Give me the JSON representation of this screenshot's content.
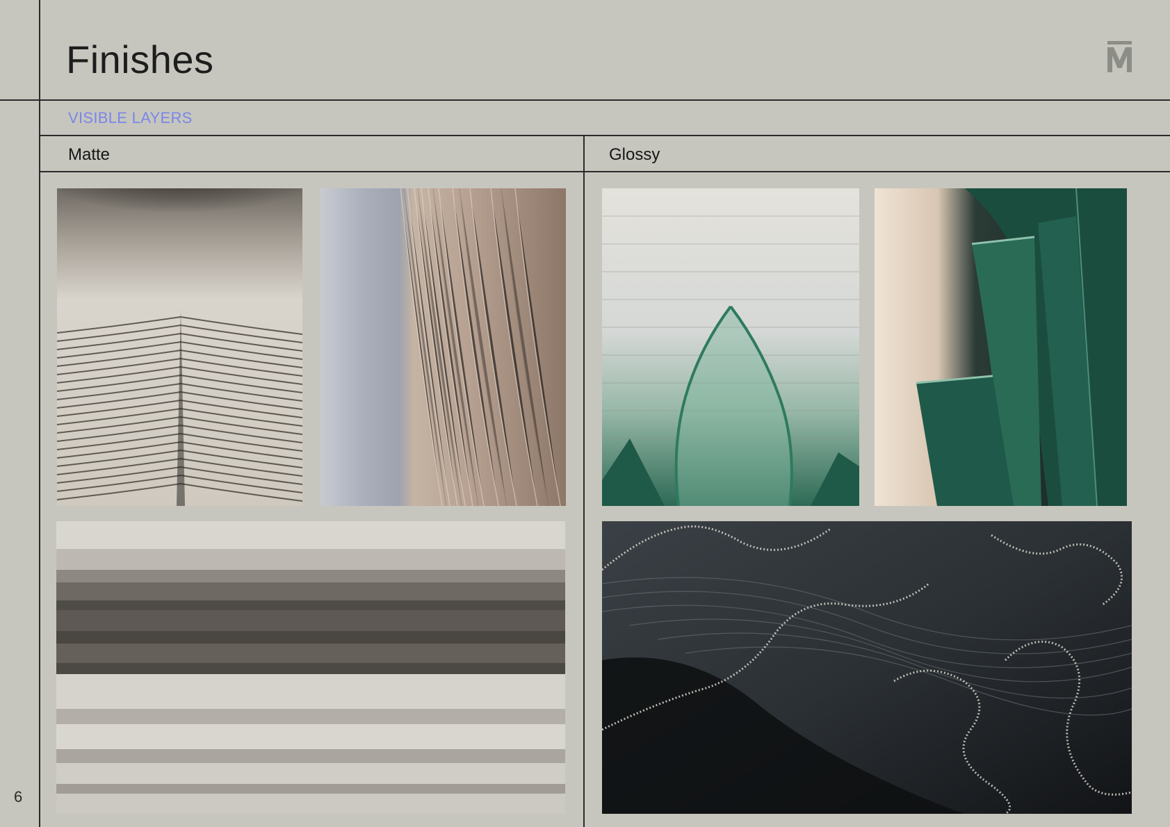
{
  "page": {
    "title": "Finishes",
    "section_label": "VISIBLE LAYERS",
    "page_number": "6"
  },
  "logo": {
    "icon": "m-monogram-logo"
  },
  "columns": [
    {
      "label": "Matte"
    },
    {
      "label": "Glossy"
    }
  ],
  "photos": [
    {
      "subject": "matte-beige-layered-vessel-closeup",
      "colors": [
        "#d8d3cc",
        "#8a8378"
      ]
    },
    {
      "subject": "matte-beige-textured-wall-closeup",
      "colors": [
        "#b8a393",
        "#aab0bd"
      ]
    },
    {
      "subject": "glossy-translucent-green-vessel",
      "colors": [
        "#d9dbd8",
        "#1f6e55"
      ]
    },
    {
      "subject": "glossy-dark-green-fins",
      "colors": [
        "#1f5a48",
        "#e8dccd"
      ]
    },
    {
      "subject": "matte-grey-layered-texture-wide",
      "colors": [
        "#d2cfca",
        "#4e4a46"
      ]
    },
    {
      "subject": "glossy-black-sparkle-surface-wide",
      "colors": [
        "#2a2f33",
        "#d8d6cc"
      ]
    }
  ]
}
